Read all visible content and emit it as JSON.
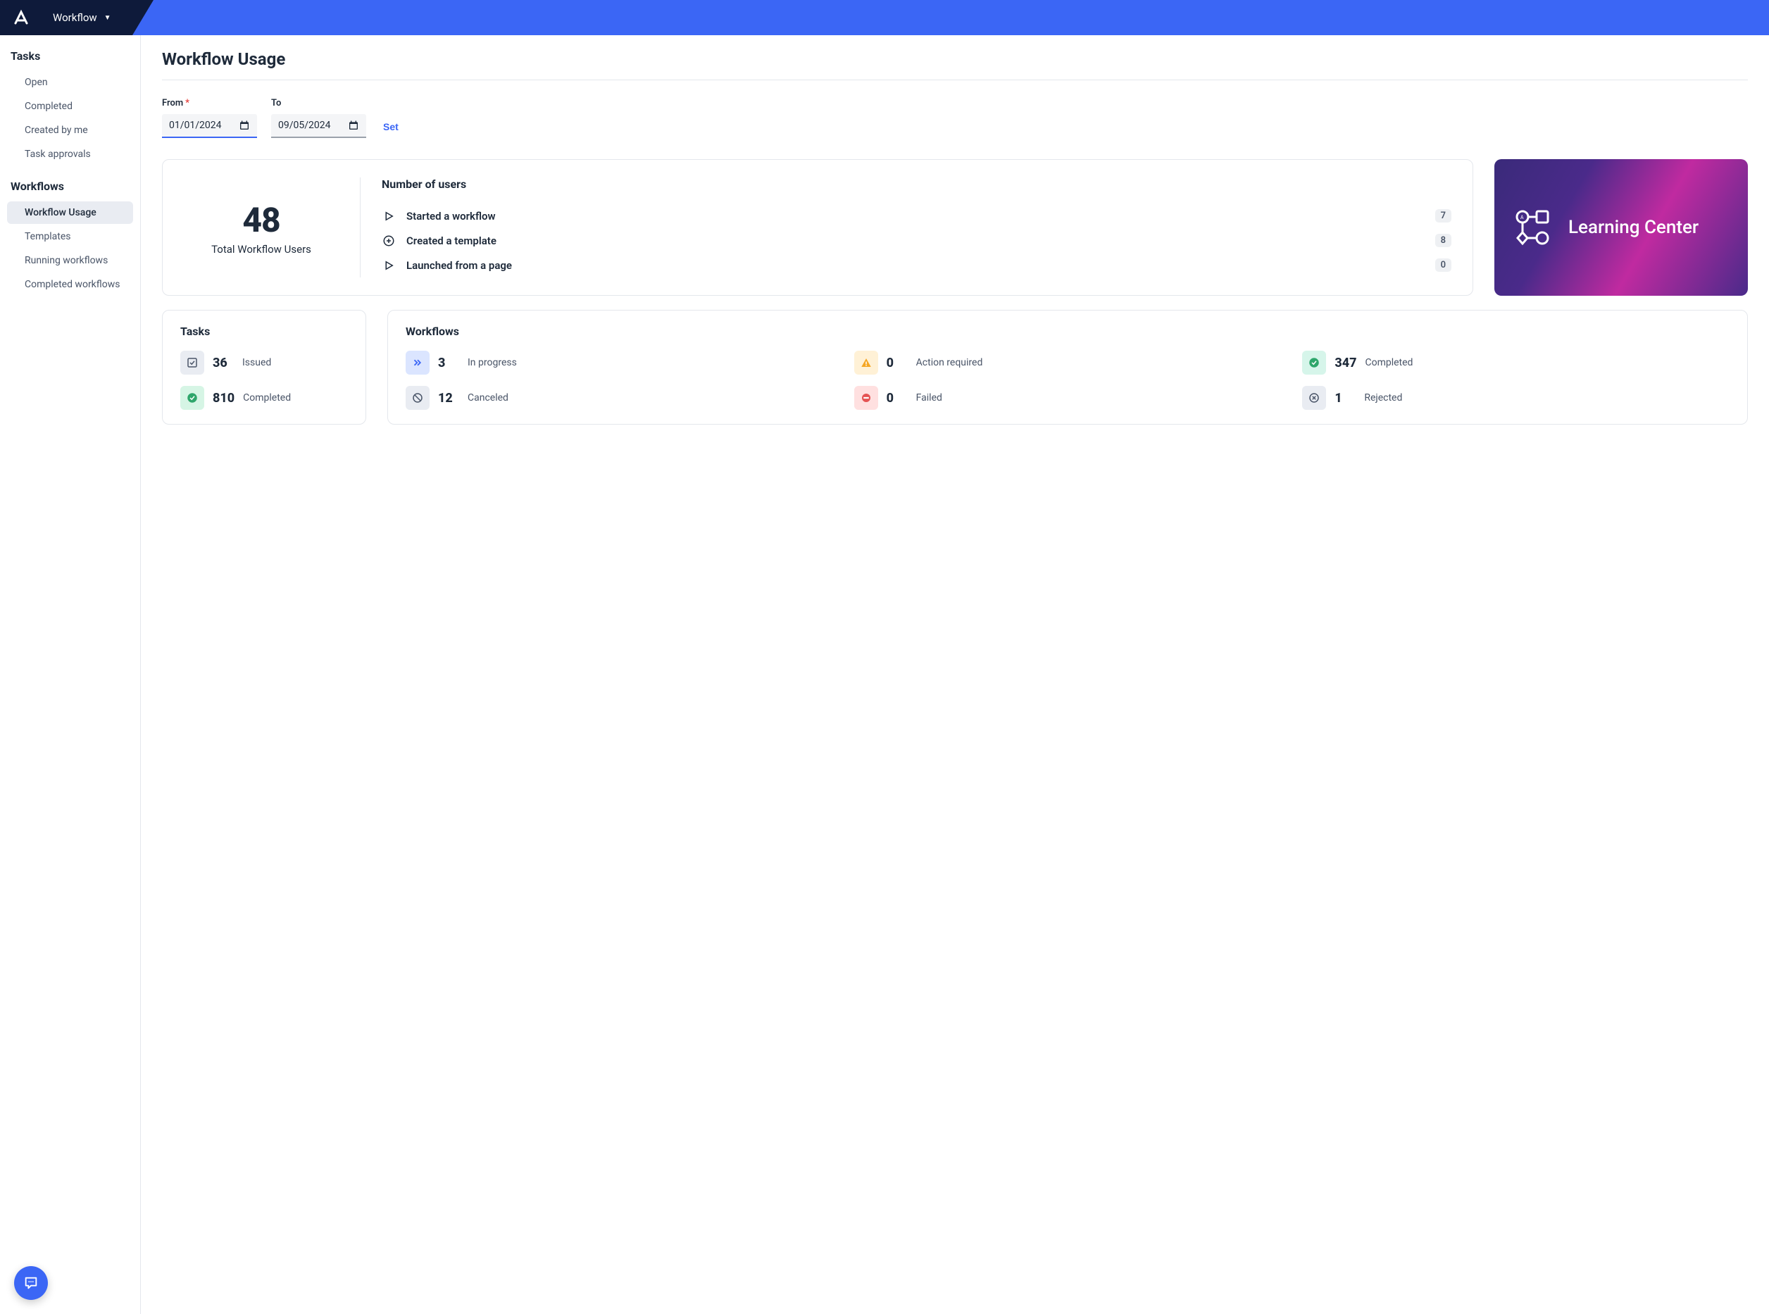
{
  "header": {
    "app_name": "Workflow"
  },
  "sidebar": {
    "groups": [
      {
        "title": "Tasks",
        "items": [
          {
            "label": "Open",
            "active": false
          },
          {
            "label": "Completed",
            "active": false
          },
          {
            "label": "Created by me",
            "active": false
          },
          {
            "label": "Task approvals",
            "active": false
          }
        ]
      },
      {
        "title": "Workflows",
        "items": [
          {
            "label": "Workflow Usage",
            "active": true
          },
          {
            "label": "Templates",
            "active": false
          },
          {
            "label": "Running workflows",
            "active": false
          },
          {
            "label": "Completed workflows",
            "active": false
          }
        ]
      }
    ]
  },
  "page": {
    "title": "Workflow Usage",
    "from_label": "From",
    "to_label": "To",
    "from_value": "01/01/2024",
    "to_value": "09/05/2024",
    "set_label": "Set"
  },
  "summary": {
    "total_value": "48",
    "total_label": "Total Workflow Users",
    "users_title": "Number of users",
    "rows": [
      {
        "label": "Started a workflow",
        "count": "7"
      },
      {
        "label": "Created a template",
        "count": "8"
      },
      {
        "label": "Launched from a page",
        "count": "0"
      }
    ]
  },
  "learning": {
    "title": "Learning Center"
  },
  "tasks_card": {
    "title": "Tasks",
    "items": [
      {
        "value": "36",
        "label": "Issued",
        "color": "gray",
        "icon": "check-square"
      },
      {
        "value": "810",
        "label": "Completed",
        "color": "green",
        "icon": "check-circle"
      }
    ]
  },
  "workflows_card": {
    "title": "Workflows",
    "items": [
      {
        "value": "3",
        "label": "In progress",
        "color": "blue",
        "icon": "double-chevron"
      },
      {
        "value": "0",
        "label": "Action required",
        "color": "yellow",
        "icon": "warning"
      },
      {
        "value": "347",
        "label": "Completed",
        "color": "teal",
        "icon": "check-circle"
      },
      {
        "value": "12",
        "label": "Canceled",
        "color": "gray",
        "icon": "cancel"
      },
      {
        "value": "0",
        "label": "Failed",
        "color": "red",
        "icon": "stop"
      },
      {
        "value": "1",
        "label": "Rejected",
        "color": "gray",
        "icon": "x-circle"
      }
    ]
  }
}
